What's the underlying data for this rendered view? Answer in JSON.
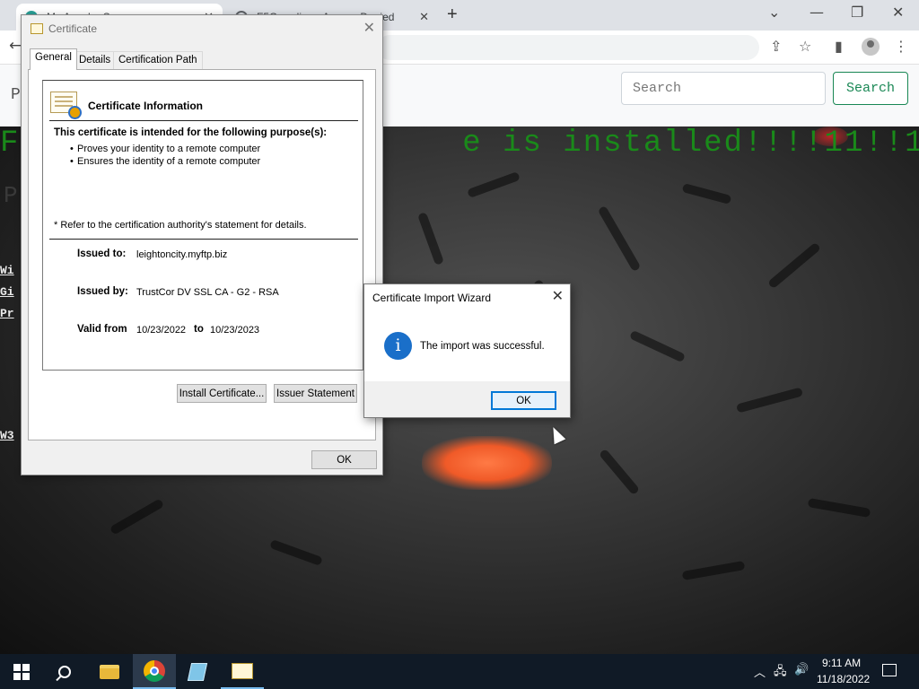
{
  "browser": {
    "tabs": [
      {
        "title": "My Apache Server",
        "favicon_color": "#2aa198"
      },
      {
        "title": "F5Guardian - Access Denied",
        "favicon_color": "#5f6368"
      }
    ],
    "new_tab_symbol": "+",
    "window_controls": {
      "chevron": "⌄",
      "minimize": "—",
      "restore": "❐",
      "close": "✕"
    },
    "back_symbol": "←",
    "toolbar_icons": {
      "share": "⇪",
      "star": "☆",
      "sidebar": "▮",
      "menu": "⋮"
    }
  },
  "page": {
    "brand_initial": "P",
    "search": {
      "placeholder": "Search",
      "button_label": "Search"
    },
    "hero_text": "F                      e is installed!!!!11!!1!",
    "hero_sub": "P",
    "side_links": [
      "Wi",
      "Gi",
      "Pr",
      "W3"
    ],
    "accent_color": "#198754"
  },
  "certificate_dialog": {
    "title": "Certificate",
    "close_symbol": "✕",
    "tabs": [
      "General",
      "Details",
      "Certification Path"
    ],
    "info_title": "Certificate Information",
    "purpose_heading": "This certificate is intended for the following purpose(s):",
    "purposes": [
      "Proves your identity to a remote computer",
      "Ensures the identity of a remote computer"
    ],
    "refer_note": "* Refer to the certification authority's statement for details.",
    "issued_to_label": "Issued to:",
    "issued_to_value": "leightoncity.myftp.biz",
    "issued_by_label": "Issued by:",
    "issued_by_value": "TrustCor DV SSL CA - G2 - RSA",
    "valid_from_label": "Valid from",
    "valid_from_value": "10/23/2022",
    "valid_to_label": "to",
    "valid_to_value": "10/23/2023",
    "install_button": "Install Certificate...",
    "issuer_button": "Issuer Statement",
    "ok_button": "OK"
  },
  "import_wizard": {
    "title": "Certificate Import Wizard",
    "close_symbol": "✕",
    "info_glyph": "i",
    "message": "The import was successful.",
    "ok_button": "OK"
  },
  "taskbar": {
    "tray_chevron": "︿",
    "tray_network": "🖧",
    "tray_volume": "🔊",
    "time": "9:11 AM",
    "date": "11/18/2022",
    "bg_color": "#101a26"
  }
}
